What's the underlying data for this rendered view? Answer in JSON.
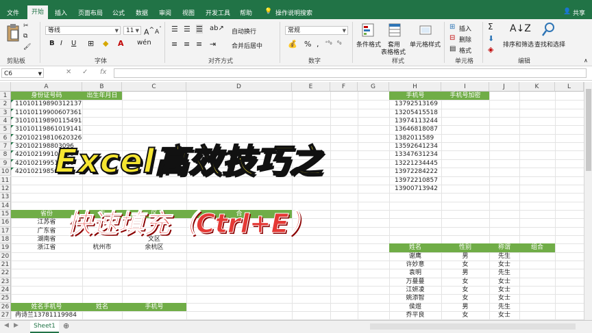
{
  "menu": {
    "tabs": [
      "文件",
      "开始",
      "插入",
      "页面布局",
      "公式",
      "数据",
      "审阅",
      "视图",
      "开发工具",
      "帮助"
    ],
    "search": "操作说明搜索",
    "share": "共享"
  },
  "ribbon": {
    "clipboard_label": "剪贴板",
    "font_name": "等线",
    "font_size": "11",
    "font_label": "字体",
    "wrap_text": "自动换行",
    "merge_center": "合并后居中",
    "align_label": "对齐方式",
    "number_format": "常规",
    "number_label": "数字",
    "cond_format": "条件格式",
    "table_format": "套用\n表格格式",
    "cell_style": "单元格样式",
    "style_label": "样式",
    "insert": "插入",
    "delete": "删除",
    "format": "格式",
    "cells_label": "单元格",
    "sort_filter": "排序和筛选",
    "find_select": "查找和选择",
    "edit_label": "编辑"
  },
  "formula_bar": {
    "name_box": "C6",
    "fx": "fx"
  },
  "sheet": {
    "columns": [
      "A",
      "B",
      "C",
      "D",
      "E",
      "F",
      "G",
      "H",
      "I",
      "J",
      "K",
      "L"
    ],
    "rows": [
      "1",
      "2",
      "3",
      "4",
      "5",
      "6",
      "7",
      "8",
      "9",
      "10",
      "11",
      "12",
      "13",
      "14",
      "15",
      "16",
      "17",
      "18",
      "19",
      "20",
      "21",
      "22",
      "23",
      "24",
      "25",
      "26",
      "27"
    ],
    "table1_headers": [
      "身份证号码",
      "出生年月日"
    ],
    "table1_ids": [
      "110101198903121372",
      "110101199006073618",
      "310101198901154914",
      "310101198610191414",
      "320102198106203269",
      "320102198803096",
      "420102199101100",
      "420102199510000",
      "420102198501000"
    ],
    "table2_headers": [
      "手机号",
      "手机号加密"
    ],
    "table2_phones": [
      "13792513169",
      "13205415518",
      "13974113244",
      "13646818087",
      "1382011589",
      "13592641234",
      "13347631234",
      "13221234445",
      "13972284222",
      "13972210857",
      "13900713942"
    ],
    "table3_headers": [
      "省份",
      "市",
      "区",
      "合"
    ],
    "table3_rows": [
      [
        "江苏省",
        "",
        ""
      ],
      [
        "广东省",
        "",
        ""
      ],
      [
        "湖南省",
        "",
        "文区"
      ],
      [
        "浙江省",
        "杭州市",
        "余杭区"
      ]
    ],
    "table4_headers": [
      "姓名",
      "性别",
      "称谓",
      "组合"
    ],
    "table4_rows": [
      [
        "谢鹰",
        "男",
        "先生"
      ],
      [
        "许妙意",
        "女",
        "女士"
      ],
      [
        "袁明",
        "男",
        "先生"
      ],
      [
        "万蔓蔓",
        "女",
        "女士"
      ],
      [
        "江妍凌",
        "女",
        "女士"
      ],
      [
        "姚添智",
        "女",
        "女士"
      ],
      [
        "侯煜",
        "男",
        "先生"
      ],
      [
        "乔平良",
        "女",
        "女士"
      ]
    ],
    "table5_headers": [
      "姓名手机号",
      "姓名",
      "手机号"
    ],
    "table5_rows": [
      [
        "冉诗兰13781119984"
      ]
    ],
    "sheet_tab": "Sheet1"
  },
  "overlay": {
    "title": "Excel高效技巧之",
    "subtitle": "快速填充（Ctrl+E）"
  },
  "colors": {
    "excel_green": "#217346",
    "header_green": "#70ad47",
    "overlay_yellow": "#f5e530",
    "overlay_red": "#e53935"
  }
}
